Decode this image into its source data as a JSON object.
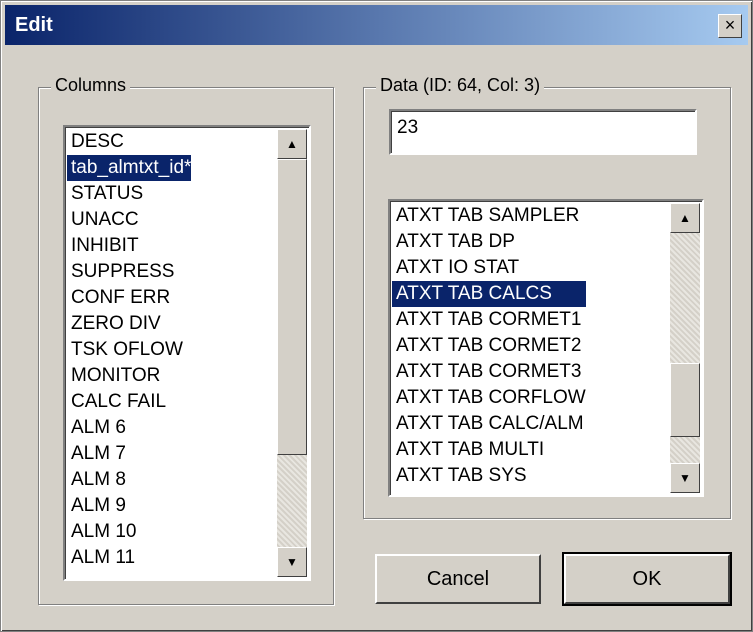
{
  "window": {
    "title": "Edit",
    "close_label": "×"
  },
  "columns_group": {
    "legend": "Columns",
    "items": [
      "DESC",
      "tab_almtxt_id*",
      "STATUS",
      "UNACC",
      "INHIBIT",
      "SUPPRESS",
      "CONF ERR",
      "ZERO DIV",
      "TSK OFLOW",
      "MONITOR",
      "CALC FAIL",
      "ALM  6",
      "ALM  7",
      "ALM  8",
      "ALM  9",
      "ALM 10",
      "ALM 11"
    ],
    "selected": "tab_almtxt_id*"
  },
  "data_group": {
    "legend": "Data (ID: 64, Col: 3)",
    "value": "23",
    "items": [
      "ATXT TAB SAMPLER",
      "ATXT TAB DP",
      "ATXT IO STAT",
      "ATXT TAB CALCS",
      "ATXT TAB CORMET1",
      "ATXT TAB CORMET2",
      "ATXT TAB CORMET3",
      "ATXT TAB CORFLOW",
      "ATXT TAB CALC/ALM",
      "ATXT TAB MULTI",
      "ATXT TAB SYS"
    ],
    "selected": "ATXT TAB CALCS"
  },
  "buttons": {
    "cancel": "Cancel",
    "ok": "OK"
  },
  "icons": {
    "scroll_up": "▲",
    "scroll_down": "▼"
  },
  "colors": {
    "title_start": "#0a246a",
    "title_end": "#a6caf0",
    "selection": "#0a246a",
    "face": "#d4d0c8"
  }
}
